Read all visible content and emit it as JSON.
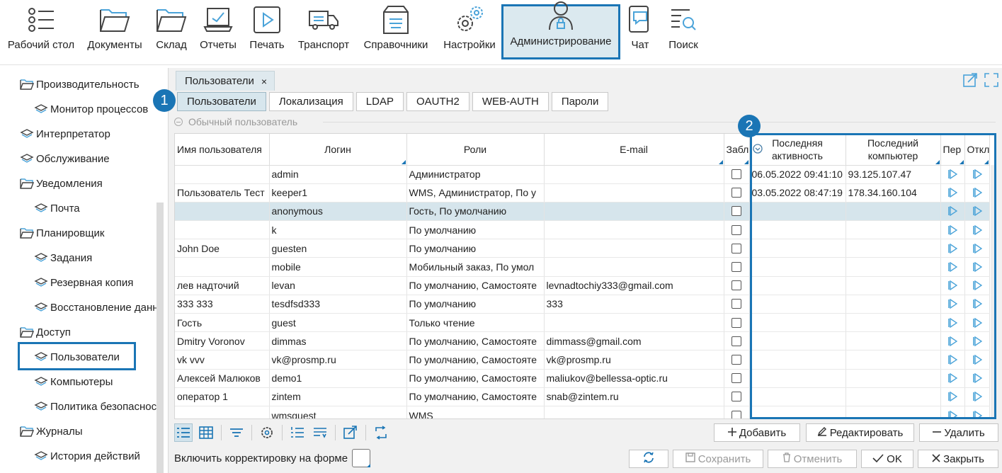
{
  "toolbar": {
    "items": [
      {
        "label": "Рабочий стол",
        "icon": "list-icon"
      },
      {
        "label": "Документы",
        "icon": "folder-icon"
      },
      {
        "label": "Склад",
        "icon": "folder-icon"
      },
      {
        "label": "Отчеты",
        "icon": "report-monitor-icon"
      },
      {
        "label": "Печать",
        "icon": "play-print-icon"
      },
      {
        "label": "Транспорт",
        "icon": "truck-icon"
      },
      {
        "label": "Справочники",
        "icon": "box-icon"
      },
      {
        "label": "Настройки",
        "icon": "gears-icon"
      },
      {
        "label": "Администрирование",
        "icon": "user-lock-icon"
      },
      {
        "label": "Чат",
        "icon": "chat-icon"
      },
      {
        "label": "Поиск",
        "icon": "search-list-icon"
      }
    ],
    "active": "Администрирование"
  },
  "sidebar": {
    "items": [
      {
        "label": "Производительность",
        "type": "folder"
      },
      {
        "label": "Монитор процессов",
        "type": "leaf"
      },
      {
        "label": "Интерпретатор",
        "type": "leaf-top"
      },
      {
        "label": "Обслуживание",
        "type": "leaf-top"
      },
      {
        "label": "Уведомления",
        "type": "folder"
      },
      {
        "label": "Почта",
        "type": "leaf"
      },
      {
        "label": "Планировщик",
        "type": "folder"
      },
      {
        "label": "Задания",
        "type": "leaf"
      },
      {
        "label": "Резервная копия",
        "type": "leaf"
      },
      {
        "label": "Восстановление данн",
        "type": "leaf"
      },
      {
        "label": "Доступ",
        "type": "folder"
      },
      {
        "label": "Пользователи",
        "type": "leaf"
      },
      {
        "label": "Компьютеры",
        "type": "leaf"
      },
      {
        "label": "Политика безопасност",
        "type": "leaf"
      },
      {
        "label": "Журналы",
        "type": "folder"
      },
      {
        "label": "История действий",
        "type": "leaf"
      }
    ],
    "selected": "Пользователи"
  },
  "doc_tab": {
    "label": "Пользователи",
    "close": "×"
  },
  "subtabs": [
    "Пользователи",
    "Локализация",
    "LDAP",
    "OAUTH2",
    "WEB-AUTH",
    "Пароли"
  ],
  "subtab_selected": "Пользователи",
  "badges": [
    "1",
    "2"
  ],
  "group": {
    "label": "Обычный пользователь"
  },
  "grid": {
    "headers": {
      "name": "Имя пользователя",
      "login": "Логин",
      "roles": "Роли",
      "email": "E-mail",
      "blocked": "Забл",
      "last_activity_1": "Последняя",
      "last_activity_2": "активность",
      "last_computer_1": "Последний",
      "last_computer_2": "компьютер",
      "col_per": "Пер",
      "col_otk": "Откл"
    },
    "rows": [
      {
        "name": "",
        "login": "admin",
        "roles": "Администратор",
        "email": "",
        "activity": "06.05.2022 09:41:10",
        "computer": "93.125.107.47"
      },
      {
        "name": "Пользователь Тест",
        "login": "keeper1",
        "roles": "WMS, Администратор, По у",
        "email": "",
        "activity": "03.05.2022 08:47:19",
        "computer": "178.34.160.104"
      },
      {
        "name": "",
        "login": "anonymous",
        "roles": "Гость, По умолчанию",
        "email": "",
        "activity": "",
        "computer": ""
      },
      {
        "name": "",
        "login": "k",
        "roles": "По умолчанию",
        "email": "",
        "activity": "",
        "computer": ""
      },
      {
        "name": "John Doe",
        "login": "guesten",
        "roles": "По умолчанию",
        "email": "",
        "activity": "",
        "computer": ""
      },
      {
        "name": "",
        "login": "mobile",
        "roles": "Мобильный заказ, По умол",
        "email": "",
        "activity": "",
        "computer": ""
      },
      {
        "name": "лев надточий",
        "login": "levan",
        "roles": "По умолчанию, Самостояте",
        "email": "levnadtochiy333@gmail.com",
        "activity": "",
        "computer": ""
      },
      {
        "name": "333 333",
        "login": "tesdfsd333",
        "roles": "По умолчанию",
        "email": "333",
        "activity": "",
        "computer": ""
      },
      {
        "name": "Гость",
        "login": "guest",
        "roles": "Только чтение",
        "email": "",
        "activity": "",
        "computer": ""
      },
      {
        "name": "Dmitry Voronov",
        "login": "dimmas",
        "roles": "По умолчанию, Самостояте",
        "email": "dimmass@gmail.com",
        "activity": "",
        "computer": ""
      },
      {
        "name": "vk vvv",
        "login": "vk@prosmp.ru",
        "roles": "По умолчанию, Самостояте",
        "email": "vk@prosmp.ru",
        "activity": "",
        "computer": ""
      },
      {
        "name": "Алексей Малюков",
        "login": "demo1",
        "roles": "По умолчанию, Самостояте",
        "email": "maliukov@bellessa-optic.ru",
        "activity": "",
        "computer": ""
      },
      {
        "name": "оператор 1",
        "login": "zintem",
        "roles": "По умолчанию, Самостояте",
        "email": "snab@zintem.ru",
        "activity": "",
        "computer": ""
      },
      {
        "name": "",
        "login": "wmsguest",
        "roles": "WMS",
        "email": "",
        "activity": "",
        "computer": ""
      }
    ],
    "selected_row": 2
  },
  "actions": {
    "add": "Добавить",
    "edit": "Редактировать",
    "delete": "Удалить"
  },
  "footer": {
    "edit_on_form": "Включить корректировку на форме",
    "save": "Сохранить",
    "cancel": "Отменить",
    "ok": "OK",
    "close": "Закрыть"
  },
  "colors": {
    "accent": "#1a75b5",
    "icon_blue": "#4aa3d9",
    "selection": "#d6e5ec"
  }
}
